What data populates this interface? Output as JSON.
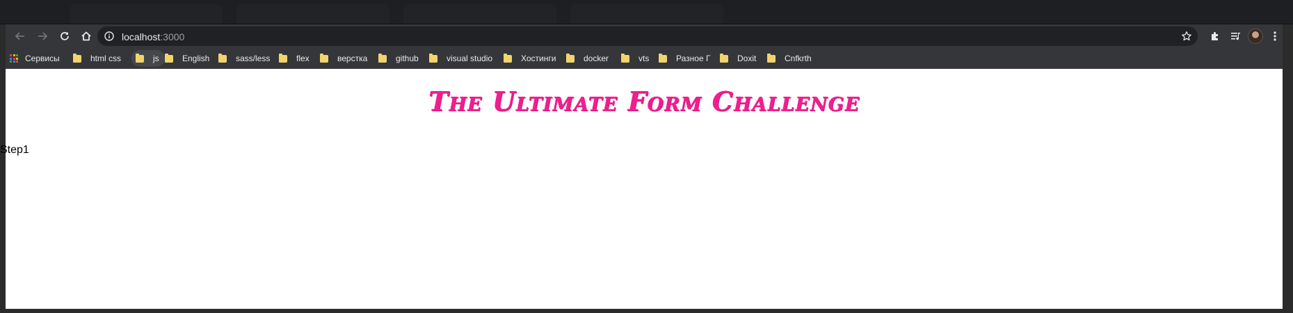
{
  "browser": {
    "address_bar": {
      "host": "localhost",
      "port": ":3000"
    },
    "bookmarks": [
      {
        "label": "Сервисы",
        "icon": "apps-grid-icon"
      },
      {
        "label": "html css",
        "icon": "folder-icon"
      },
      {
        "label": "js",
        "icon": "folder-icon",
        "active": true
      },
      {
        "label": "English",
        "icon": "folder-icon"
      },
      {
        "label": "sass/less",
        "icon": "folder-icon"
      },
      {
        "label": "flex",
        "icon": "folder-icon"
      },
      {
        "label": "верстка",
        "icon": "folder-icon"
      },
      {
        "label": "github",
        "icon": "folder-icon"
      },
      {
        "label": "visual studio",
        "icon": "folder-icon"
      },
      {
        "label": "Хостинги",
        "icon": "folder-icon"
      },
      {
        "label": "docker",
        "icon": "folder-icon"
      },
      {
        "label": "vts",
        "icon": "folder-icon"
      },
      {
        "label": "Разное Г",
        "icon": "folder-icon"
      },
      {
        "label": "Doxit",
        "icon": "folder-icon"
      },
      {
        "label": "Cnfkrth",
        "icon": "folder-icon"
      }
    ]
  },
  "page": {
    "title": "The Ultimate Form Challenge",
    "step": "Step1"
  },
  "colors": {
    "title": "#f01e8f",
    "folder": "#f2d46c",
    "chrome_bg": "#35363a",
    "omnibox_bg": "#202124"
  }
}
